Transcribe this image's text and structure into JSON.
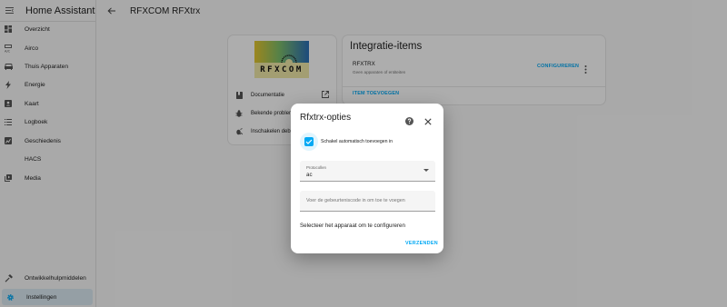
{
  "app": {
    "title": "Home Assistant"
  },
  "sidebar": {
    "items": [
      {
        "label": "Overzicht",
        "icon": "dashboard-icon"
      },
      {
        "label": "Airco",
        "icon": "air-conditioner-icon"
      },
      {
        "label": "Thuis Apparaten",
        "icon": "sofa-icon"
      },
      {
        "label": "Energie",
        "icon": "lightning-icon"
      },
      {
        "label": "Kaart",
        "icon": "map-account-icon"
      },
      {
        "label": "Logboek",
        "icon": "list-icon"
      },
      {
        "label": "Geschiedenis",
        "icon": "chart-box-icon"
      },
      {
        "label": "HACS",
        "icon": "hacs-icon"
      },
      {
        "label": "Media",
        "icon": "media-library-icon"
      }
    ],
    "bottom": [
      {
        "label": "Ontwikkelhulpmiddelen",
        "icon": "hammer-icon"
      },
      {
        "label": "Instellingen",
        "icon": "gear-icon"
      }
    ]
  },
  "header": {
    "title": "RFXCOM RFXtrx"
  },
  "info_card": {
    "logo_text": "RFXCOM",
    "rows": [
      {
        "label": "Documentatie",
        "icon": "book-icon"
      },
      {
        "label": "Bekende problemen",
        "icon": "bug-icon"
      },
      {
        "label": "Inschakelen debug-logboek",
        "icon": "debug-icon"
      }
    ]
  },
  "integration_card": {
    "title": "Integratie-items",
    "device_name": "RFXTRX",
    "device_sub": "Geen apparaten of entiteiten",
    "configure_label": "CONFIGUREREN",
    "add_label": "ITEM TOEVOEGEN"
  },
  "dialog": {
    "title": "Rfxtrx-opties",
    "checkbox_label": "Schakel automatisch toevoegen in",
    "checkbox_checked": true,
    "select_label": "Protocollen",
    "select_value": "ac",
    "input_placeholder": "Voer de gebeurteniscode in om toe te voegen",
    "device_text": "Selecteer het apparaat om te configureren",
    "submit_label": "VERZENDEN"
  },
  "colors": {
    "accent": "#03a9f4",
    "active_bg": "#dcebf3"
  }
}
